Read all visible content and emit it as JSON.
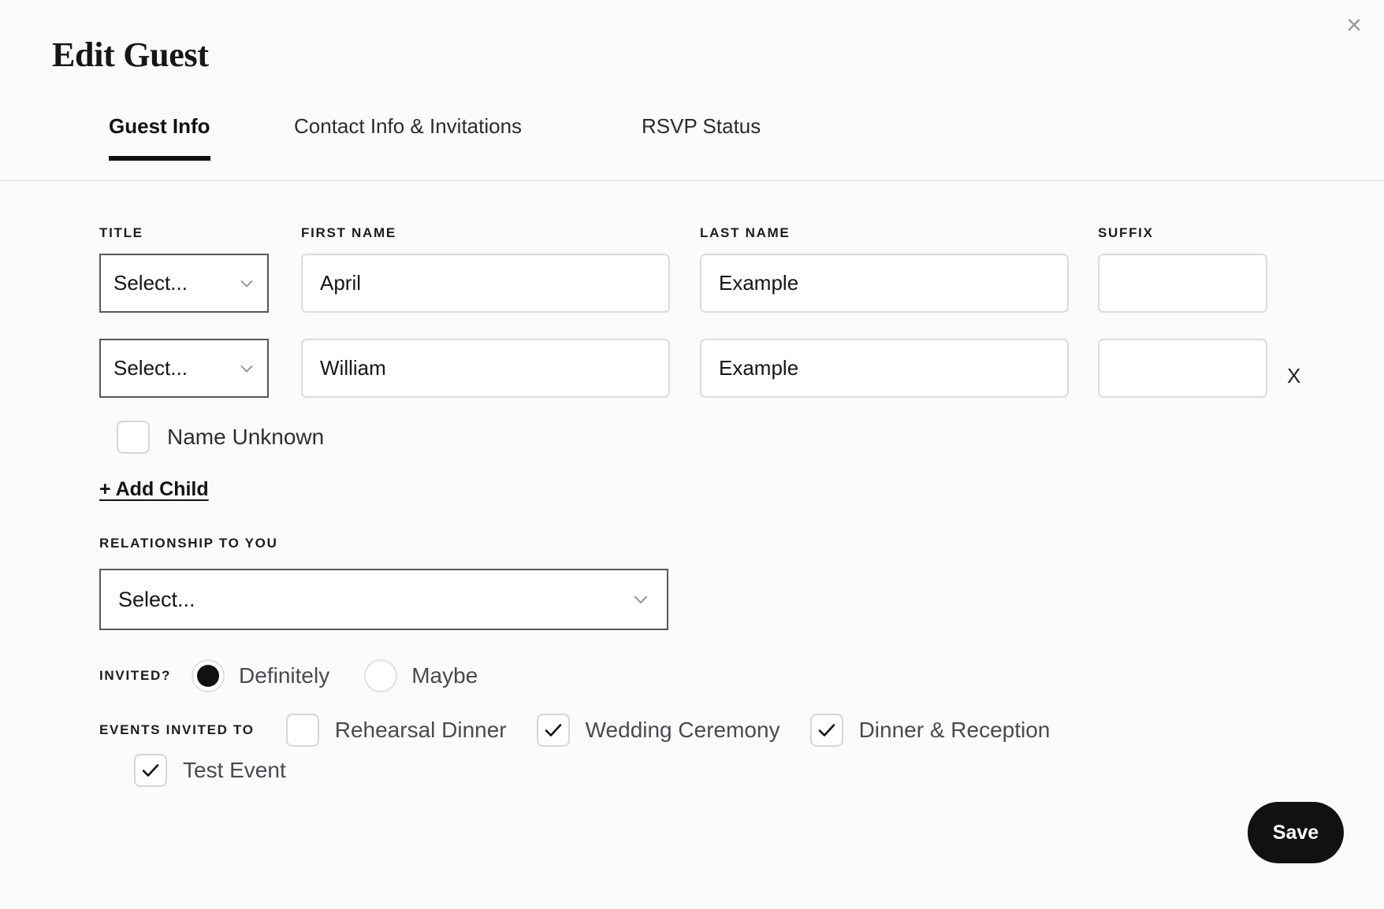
{
  "modal": {
    "title": "Edit Guest",
    "close_icon": "close-icon",
    "close_glyph": "×"
  },
  "tabs": [
    {
      "label": "Guest Info",
      "active": true
    },
    {
      "label": "Contact Info & Invitations",
      "active": false
    },
    {
      "label": "RSVP Status",
      "active": false
    }
  ],
  "labels": {
    "title": "TITLE",
    "first_name": "FIRST NAME",
    "last_name": "LAST NAME",
    "suffix": "SUFFIX",
    "relationship": "RELATIONSHIP TO YOU",
    "invited": "INVITED?",
    "events_invited_to": "EVENTS INVITED TO"
  },
  "guests": [
    {
      "title_value": "Select...",
      "first_name": "April",
      "last_name": "Example",
      "suffix": "",
      "removable": false
    },
    {
      "title_value": "Select...",
      "first_name": "William",
      "last_name": "Example",
      "suffix": "",
      "removable": true,
      "remove_label": "X"
    }
  ],
  "placeholders": {
    "first_name": "",
    "last_name": "",
    "suffix": ""
  },
  "name_unknown": {
    "label": "Name Unknown",
    "checked": false
  },
  "add_child": {
    "label": "+ Add Child"
  },
  "relationship": {
    "value": "Select..."
  },
  "invited_options": [
    {
      "label": "Definitely",
      "selected": true
    },
    {
      "label": "Maybe",
      "selected": false
    }
  ],
  "events": [
    {
      "label": "Rehearsal Dinner",
      "checked": false
    },
    {
      "label": "Wedding Ceremony",
      "checked": true
    },
    {
      "label": "Dinner & Reception",
      "checked": true
    },
    {
      "label": "Test Event",
      "checked": true
    }
  ],
  "save_button": {
    "label": "Save"
  },
  "colors": {
    "background": "#fbfbfb",
    "text": "#15151a",
    "accent": "#111114",
    "muted": "#4a4a50",
    "border_light": "#dcdcdc",
    "border_dark": "#58585c"
  }
}
